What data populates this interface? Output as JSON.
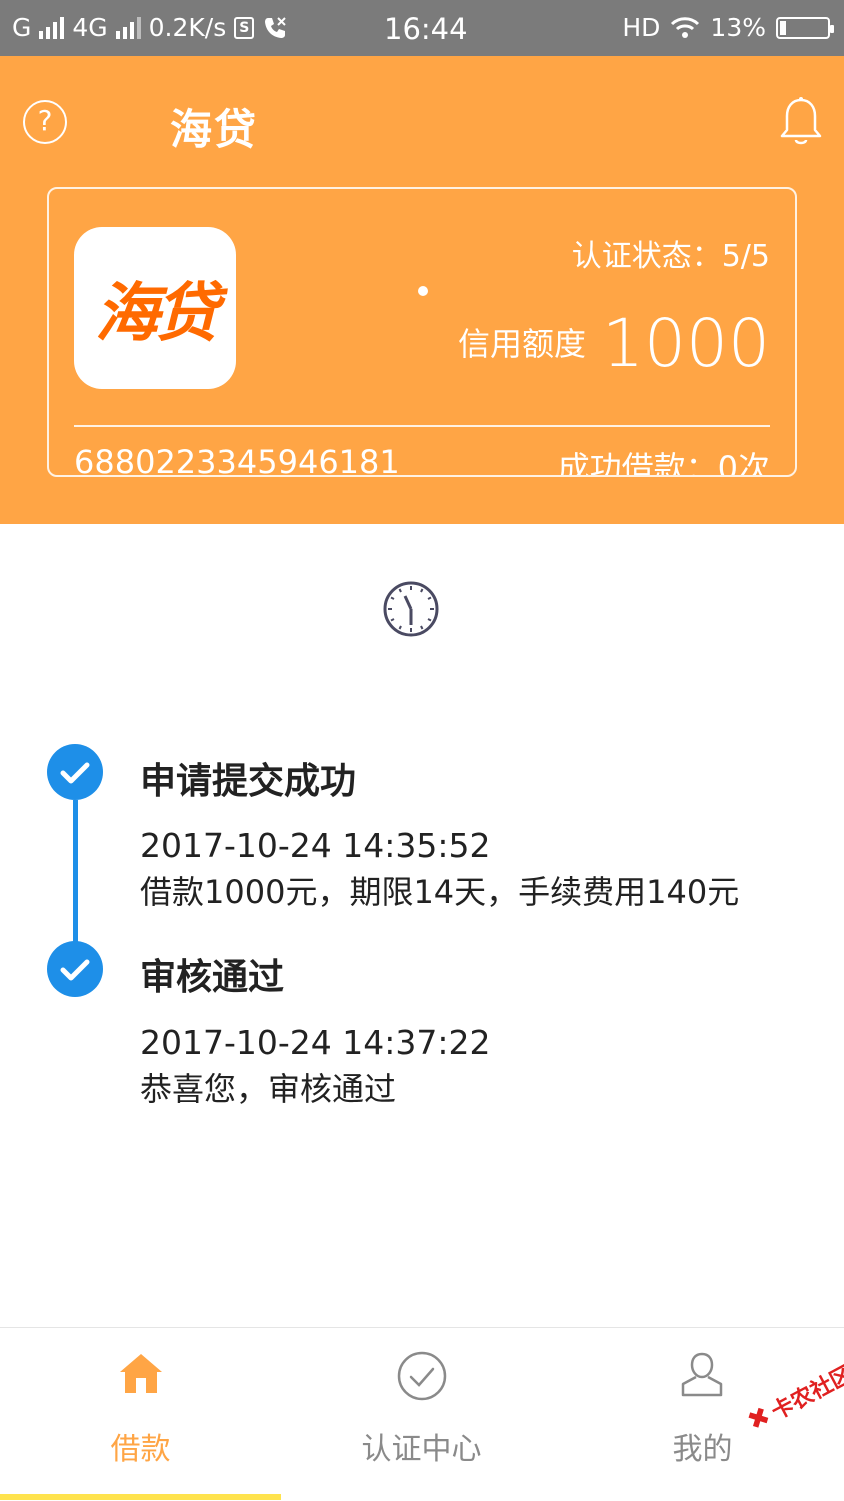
{
  "status_bar": {
    "carrier1": "G",
    "carrier2": "4G",
    "speed": "0.2K/s",
    "time": "16:44",
    "hd": "HD",
    "battery": "13%",
    "icons": [
      "signal-icon",
      "sim-icon",
      "call-icon",
      "wifi-icon",
      "battery-icon"
    ]
  },
  "header": {
    "title": "海贷",
    "help_icon": "question-circle-icon",
    "bell_icon": "bell-icon",
    "background_color": "#ffa545"
  },
  "card": {
    "logo_text": "海贷",
    "auth_status": "认证状态：5/5",
    "credit_label": "信用额度",
    "credit_value": "1000",
    "card_id": "6880223345946181",
    "success_count": "成功借款：0次"
  },
  "timeline": {
    "accent_color": "#1e8fe8",
    "steps": [
      {
        "title": "申请提交成功",
        "time": "2017-10-24 14:35:52",
        "desc": "借款1000元，期限14天，手续费用140元"
      },
      {
        "title": "审核通过",
        "time": "2017-10-24 14:37:22",
        "desc": "恭喜您，审核通过"
      }
    ]
  },
  "nav": {
    "items": [
      {
        "label": "借款",
        "icon": "home-icon",
        "active": true
      },
      {
        "label": "认证中心",
        "icon": "check-circle-icon",
        "active": false
      },
      {
        "label": "我的",
        "icon": "user-icon",
        "active": false
      }
    ],
    "active_color": "#ffa545",
    "indicator_color": "#ffe34d"
  },
  "watermark": {
    "text": "卡农社区"
  }
}
